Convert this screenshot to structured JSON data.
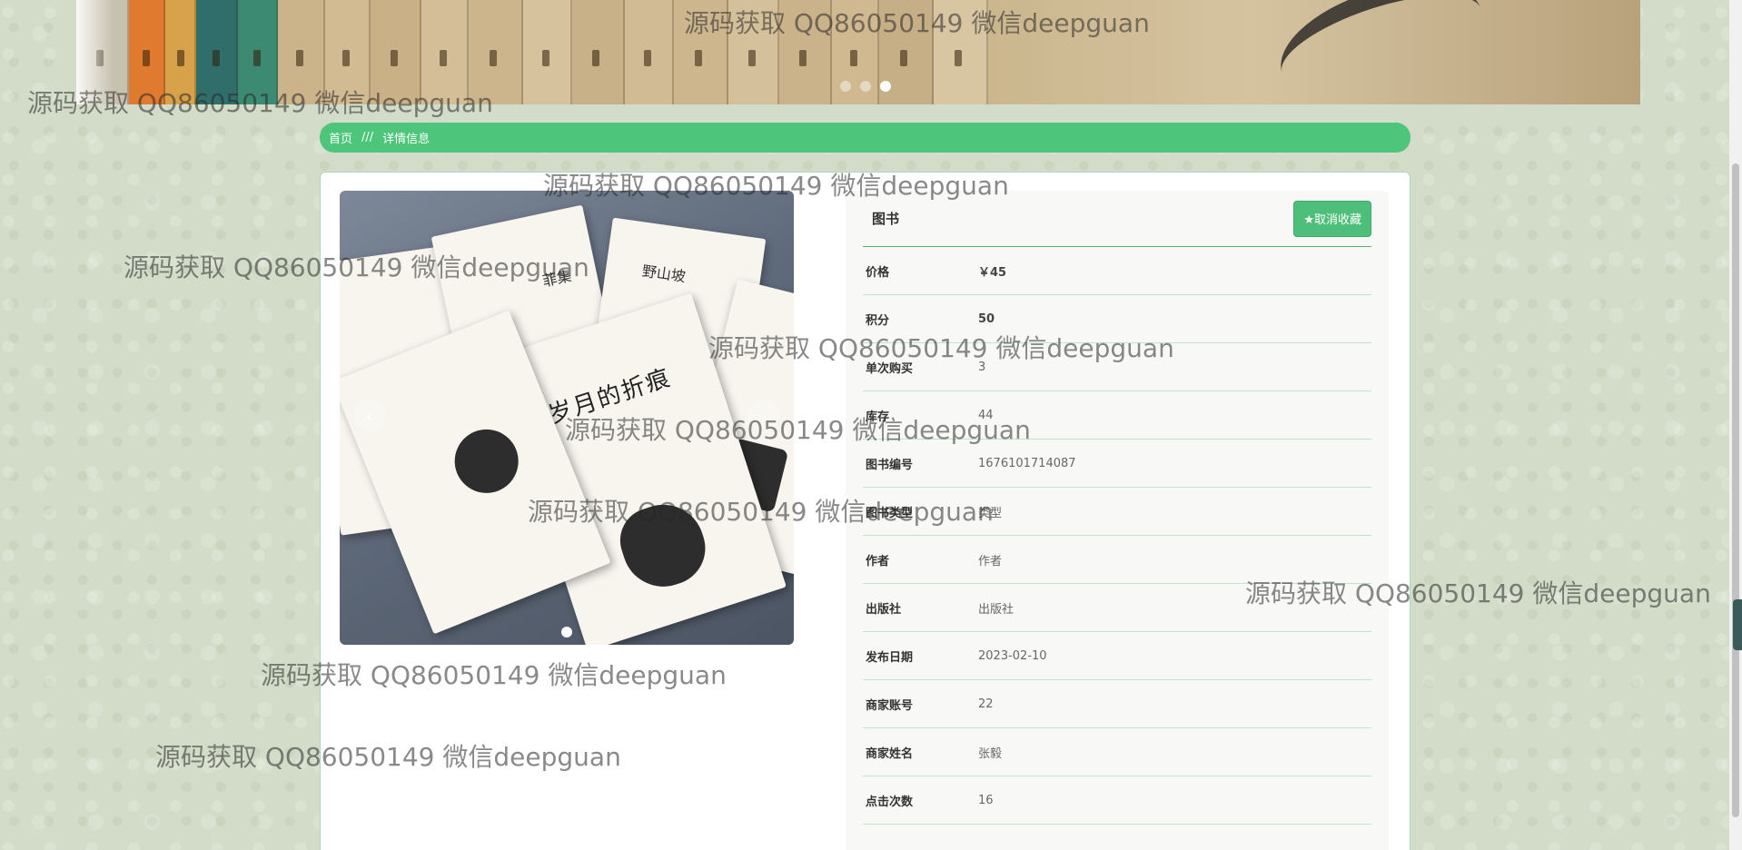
{
  "banner": {
    "slides": 3,
    "active_slide": 3
  },
  "breadcrumb": {
    "home": "首页",
    "separator": "///",
    "current": "详情信息"
  },
  "gallery": {
    "book_title_main": "岁月的折痕",
    "book_title_second": "野山坡",
    "book_title_third": "菲集",
    "prev_icon": "‹",
    "next_icon": "›",
    "slides": 1
  },
  "detail": {
    "title": "图书",
    "favorite_button": "★取消收藏",
    "rows": [
      {
        "label": "价格",
        "value": "￥45",
        "bold": true
      },
      {
        "label": "积分",
        "value": "50",
        "bold": true
      },
      {
        "label": "单次购买",
        "value": "3",
        "bold": false
      },
      {
        "label": "库存",
        "value": "44",
        "bold": false
      },
      {
        "label": "图书编号",
        "value": "1676101714087",
        "bold": false
      },
      {
        "label": "图书类型",
        "value": "类型",
        "bold": false
      },
      {
        "label": "作者",
        "value": "作者",
        "bold": false
      },
      {
        "label": "出版社",
        "value": "出版社",
        "bold": false
      },
      {
        "label": "发布日期",
        "value": "2023-02-10",
        "bold": false
      },
      {
        "label": "商家账号",
        "value": "22",
        "bold": false
      },
      {
        "label": "商家姓名",
        "value": "张毅",
        "bold": false
      },
      {
        "label": "点击次数",
        "value": "16",
        "bold": false
      }
    ]
  },
  "watermark": "源码获取 QQ86050149 微信deepguan",
  "colors": {
    "accent": "#4dc57a",
    "background": "#d3dcc8"
  }
}
